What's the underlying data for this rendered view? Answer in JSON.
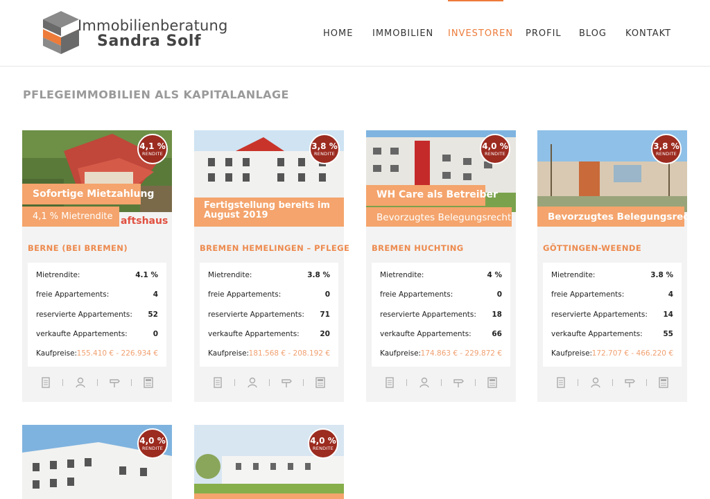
{
  "brand": {
    "line1": "Immobilienberatung",
    "line2": "Sandra Solf",
    "accent": "#ed7b3a",
    "dark": "#6a6a6a"
  },
  "nav": {
    "items": [
      "HOME",
      "IMMOBILIEN",
      "INVESTOREN",
      "PROFIL",
      "BLOG",
      "KONTAKT"
    ],
    "active": "INVESTOREN"
  },
  "page": {
    "title": "PFLEGEIMMOBILIEN ALS KAPITALANLAGE"
  },
  "labels": {
    "mietrendite": "Mietrendite:",
    "frei": "freie Appartements:",
    "reserviert": "reservierte Appartements:",
    "verkauft": "verkaufte Appartements:",
    "kaufpreise": "Kaufpreise:"
  },
  "icons": [
    "document-icon",
    "person-icon",
    "signpost-icon",
    "calculator-icon"
  ],
  "cards": [
    {
      "badge_value": "4,1 %",
      "badge_label": "RENDITE",
      "tag1": "Sofortige Mietzahlung",
      "tag2": "4,1 % Mietrendite",
      "tag2_overflow": "aftshaus",
      "location": "BERNE (BEI BREMEN)",
      "mietrendite": "4.1 %",
      "frei": "4",
      "reserviert": "52",
      "verkauft": "0",
      "kaufpreise": "155.410 € - 226.934 €"
    },
    {
      "badge_value": "3,8 %",
      "badge_label": "RENDITE",
      "tag1": "Fertigstellung bereits im",
      "tag1b": "August 2019",
      "location": "BREMEN HEMELINGEN – PFLEGE",
      "mietrendite": "3.8 %",
      "frei": "0",
      "reserviert": "71",
      "verkauft": "20",
      "kaufpreise": "181.568 € - 208.192 €"
    },
    {
      "badge_value": "4,0 %",
      "badge_label": "RENDITE",
      "tag1": "WH Care als Betreiber",
      "tag2": "Bevorzugtes Belegungsrecht",
      "location": "BREMEN HUCHTING",
      "mietrendite": "4 %",
      "frei": "0",
      "reserviert": "18",
      "verkauft": "66",
      "kaufpreise": "174.863 € - 229.872 €"
    },
    {
      "badge_value": "3,8 %",
      "badge_label": "RENDITE",
      "tag1": "Bevorzugtes Belegungsrecht",
      "location": "GÖTTINGEN-WEENDE",
      "mietrendite": "3.8 %",
      "frei": "4",
      "reserviert": "14",
      "verkauft": "55",
      "kaufpreise": "172.707 € - 466.220 €"
    },
    {
      "badge_value": "4,0 %",
      "badge_label": "RENDITE"
    },
    {
      "badge_value": "4,0 %",
      "badge_label": "RENDITE"
    }
  ]
}
